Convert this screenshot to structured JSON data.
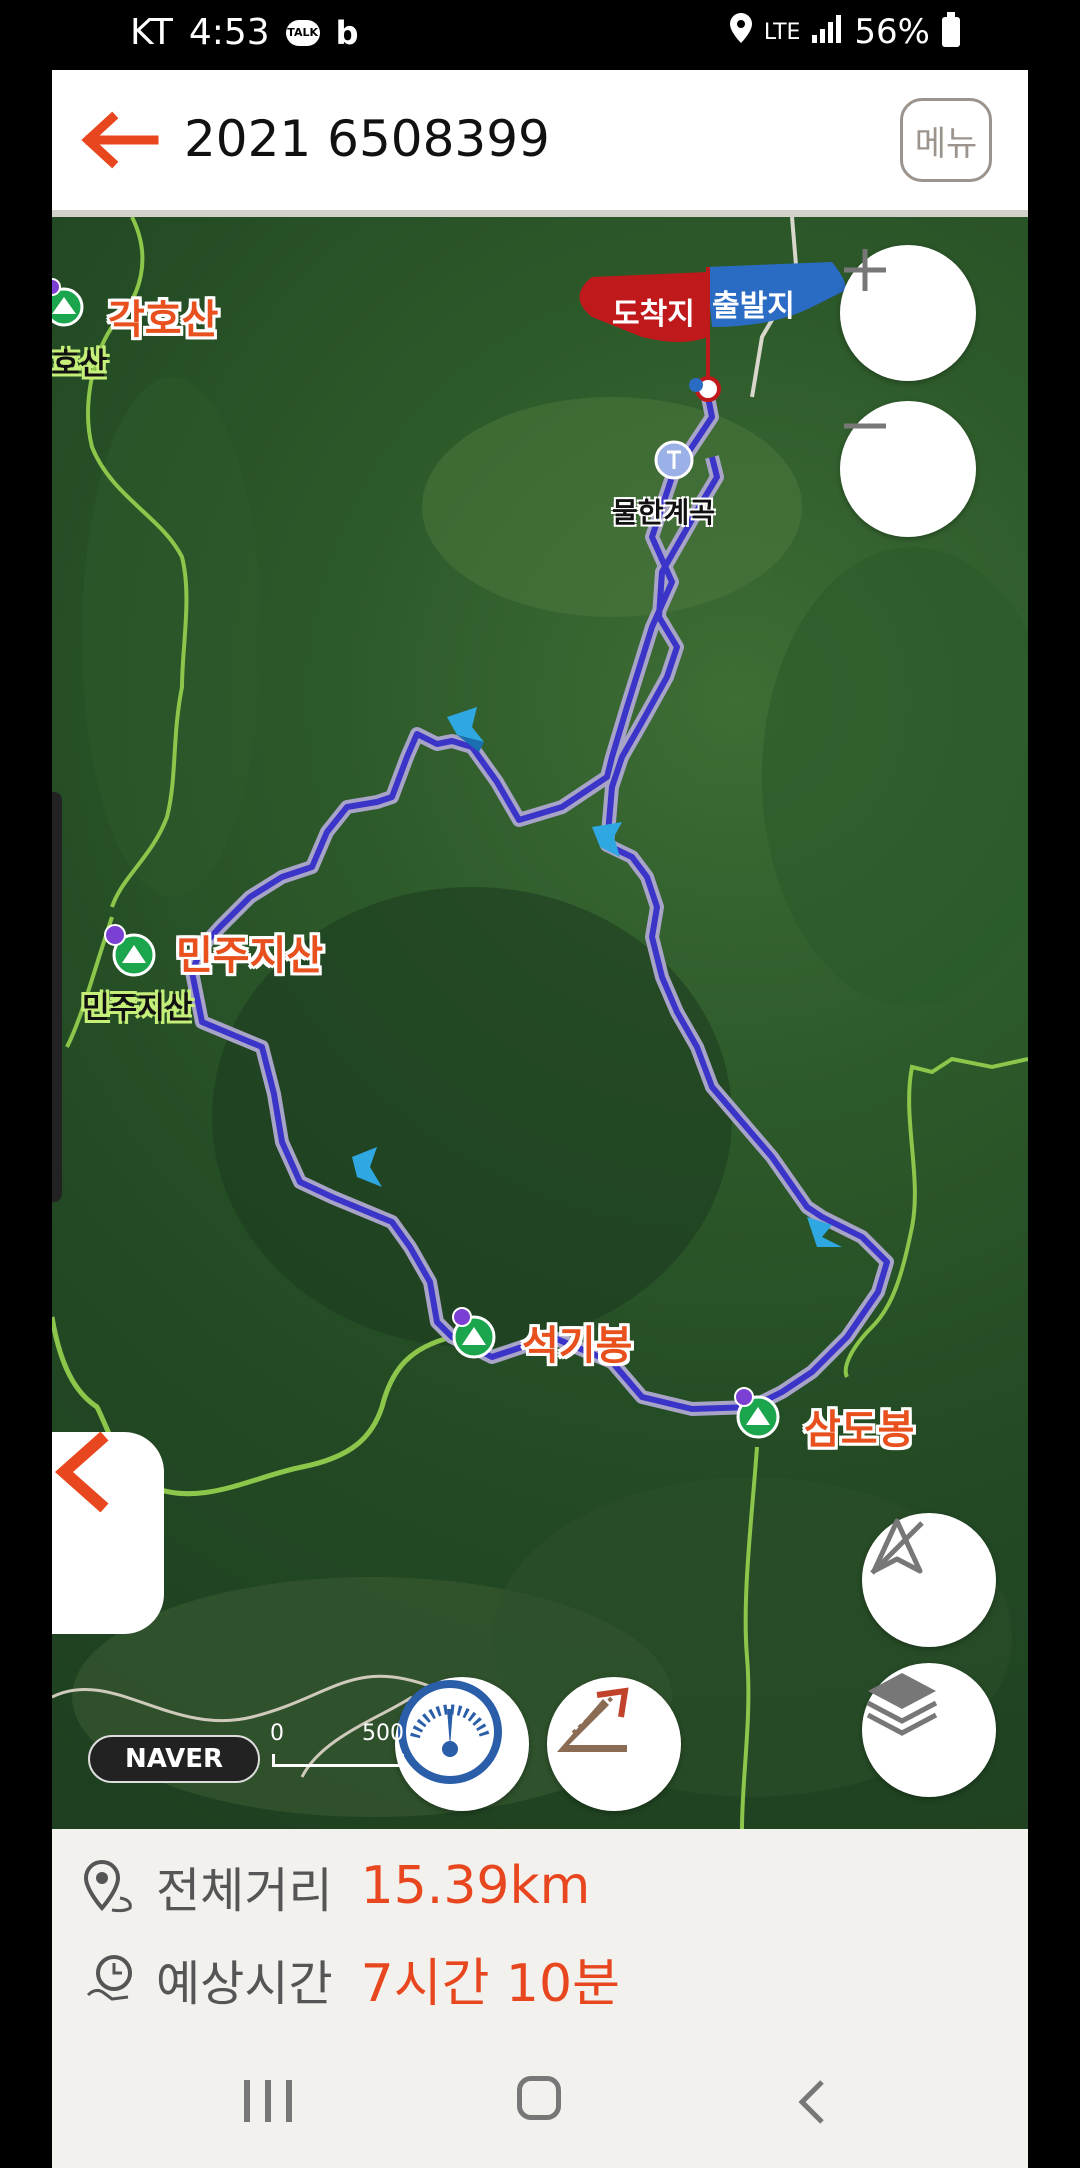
{
  "status_bar": {
    "carrier": "KT",
    "time": "4:53",
    "talk": "TALK",
    "network": "LTE",
    "battery": "56%"
  },
  "header": {
    "title": "2021 6508399",
    "menu_label": "메뉴"
  },
  "map": {
    "peaks": [
      {
        "name": "각호산",
        "sub": "호산"
      },
      {
        "name": "민주지산",
        "sub": "민주지산"
      },
      {
        "name": "석기봉"
      },
      {
        "name": "삼도봉"
      }
    ],
    "flags": {
      "arrive": "도착지",
      "depart": "출발지"
    },
    "poi": "물한계곡",
    "naver": "NAVER",
    "scale_0": "0",
    "scale_500": "500"
  },
  "summary": {
    "distance_label": "전체거리",
    "distance_value": "15.39km",
    "time_label": "예상시간",
    "time_value": "7시간 10분"
  },
  "colors": {
    "accent": "#e8461e",
    "route": "#3a34c8",
    "trail": "#8cc64a"
  }
}
